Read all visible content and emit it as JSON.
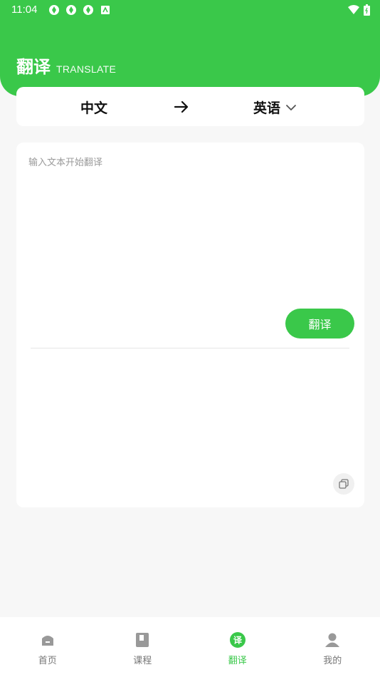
{
  "status_bar": {
    "time": "11:04"
  },
  "header": {
    "title": "翻译",
    "subtitle": "TRANSLATE"
  },
  "language": {
    "source": "中文",
    "target": "英语"
  },
  "translate": {
    "placeholder": "输入文本开始翻译",
    "button_label": "翻译"
  },
  "tabs": [
    {
      "label": "首页",
      "icon": "home-icon"
    },
    {
      "label": "课程",
      "icon": "book-icon"
    },
    {
      "label": "翻译",
      "icon": "translate-icon",
      "active": true
    },
    {
      "label": "我的",
      "icon": "user-icon"
    }
  ],
  "colors": {
    "accent": "#3ac84a",
    "background": "#f7f7f7",
    "card": "#ffffff"
  }
}
